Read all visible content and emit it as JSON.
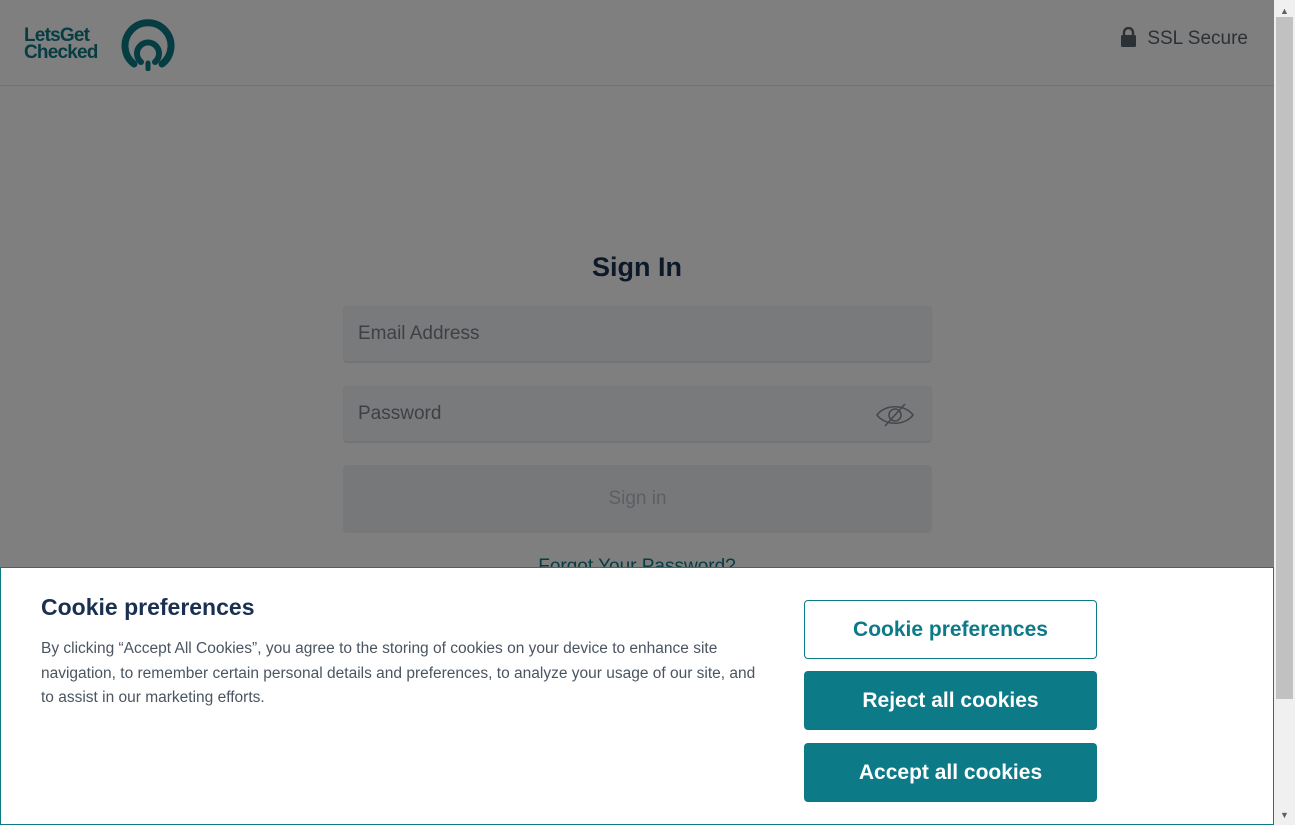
{
  "header": {
    "logo_line1": "LetsGet",
    "logo_line2": "Checked",
    "ssl_label": "SSL Secure",
    "lock_icon": "lock-icon"
  },
  "signin": {
    "title": "Sign In",
    "email_placeholder": "Email Address",
    "password_placeholder": "Password",
    "password_toggle_icon": "eye-slash-icon",
    "submit_label": "Sign in",
    "forgot_label": "Forgot Your Password?"
  },
  "cookie_banner": {
    "title": "Cookie preferences",
    "text": "By clicking “Accept All Cookies”, you agree to the storing of cookies on your device to enhance site navigation, to remember certain personal details and preferences, to analyze your usage of our site, and to assist in our marketing efforts.",
    "preferences_label": "Cookie preferences",
    "reject_label": "Reject all cookies",
    "accept_label": "Accept all cookies"
  },
  "colors": {
    "brand": "#0d7a87",
    "heading": "#1a3050",
    "overlay": "rgba(0,0,0,0.5)"
  }
}
